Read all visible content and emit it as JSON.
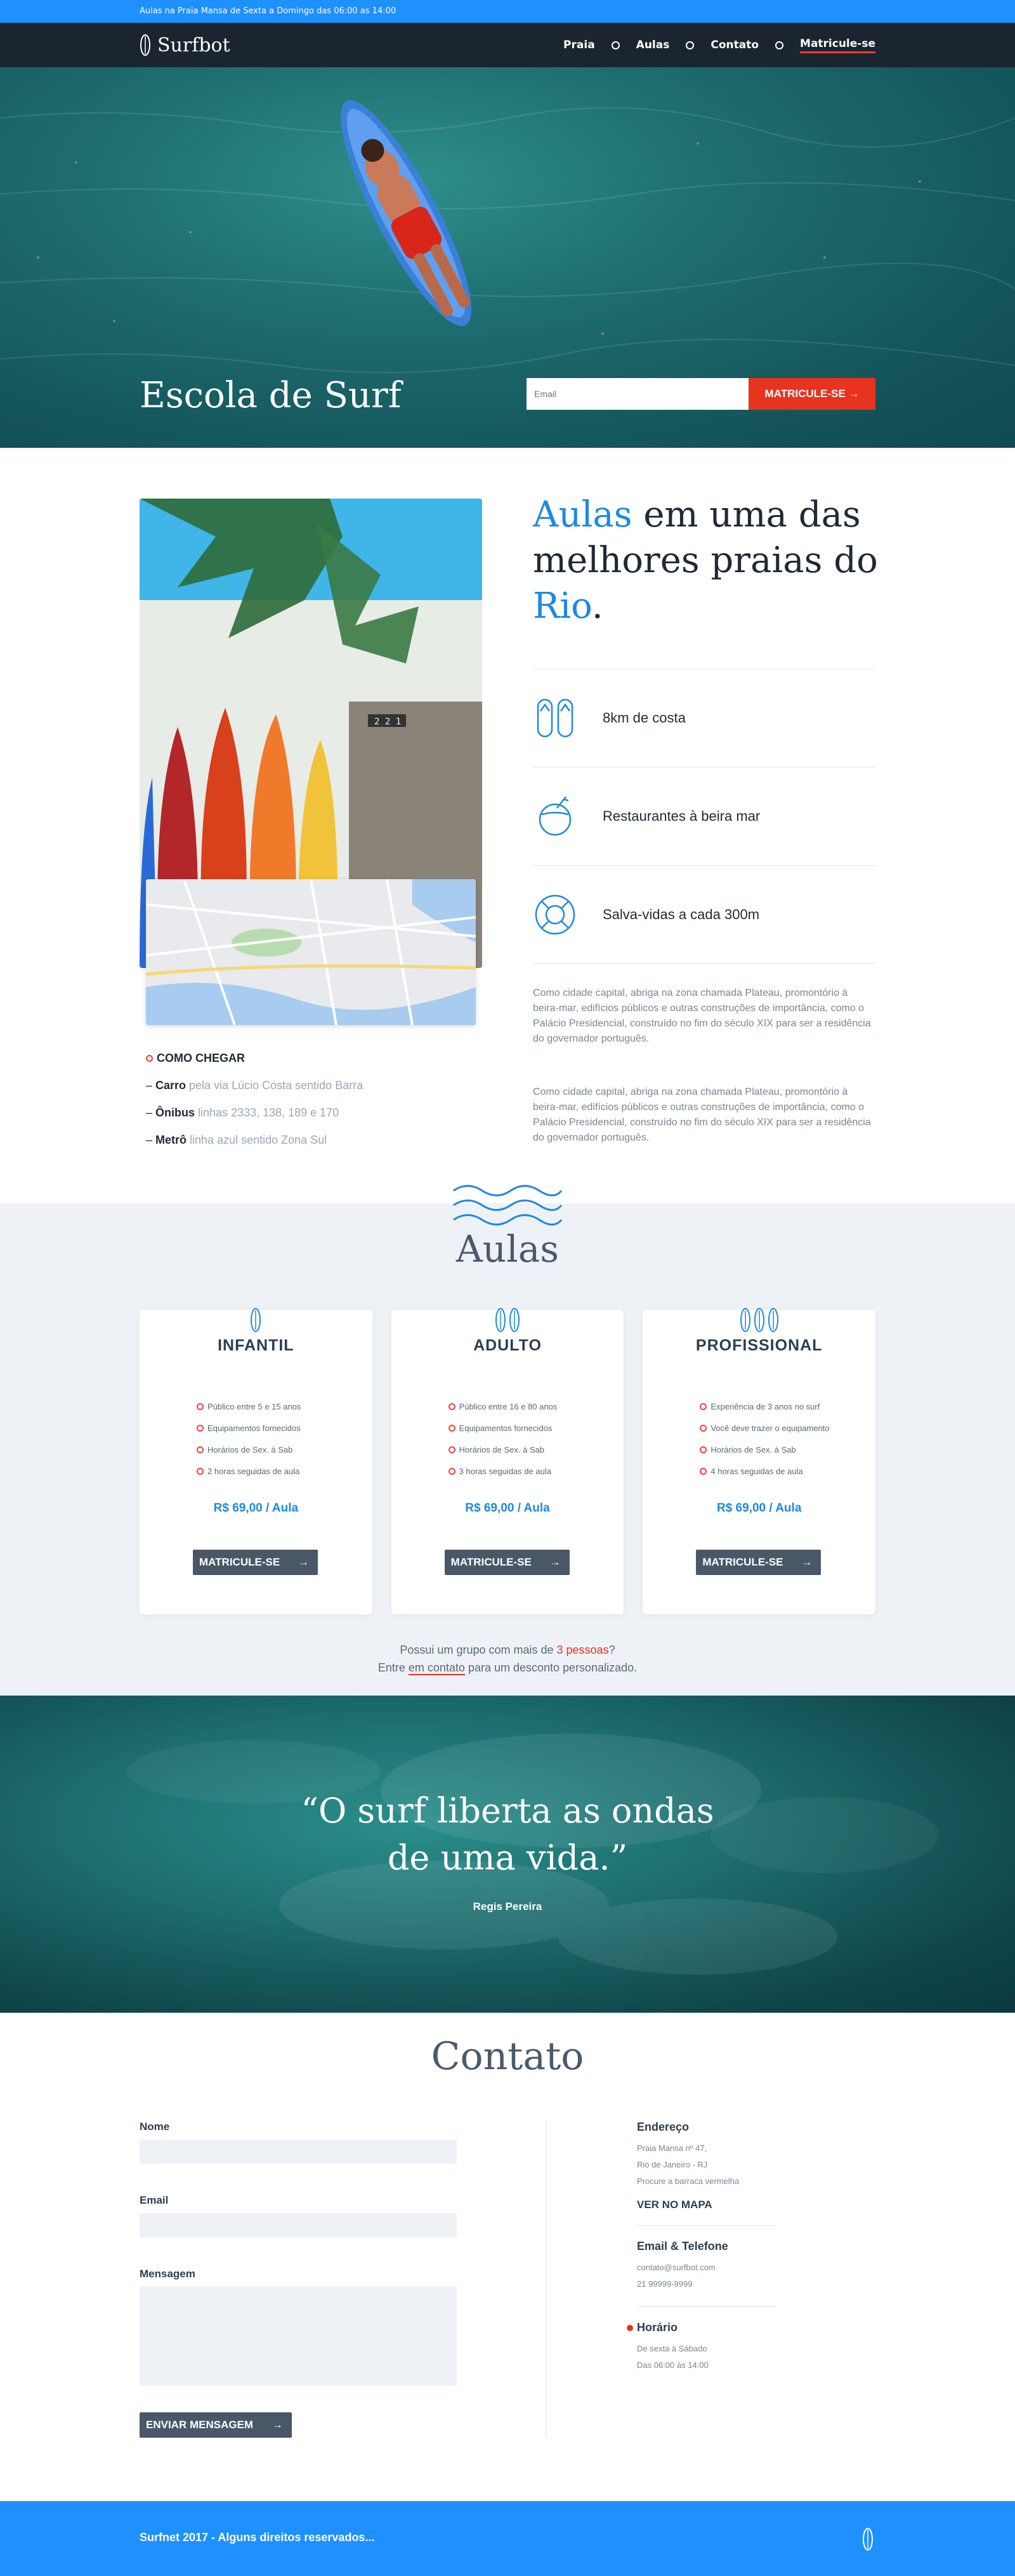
{
  "topbar": {
    "text": "Aulas na Praia Mansa de Sexta a Domingo das 06:00 as 14:00"
  },
  "nav": {
    "brand": "Surfbot",
    "links": [
      "Praia",
      "Aulas",
      "Contato",
      "Matricule-se"
    ]
  },
  "hero": {
    "title": "Escola de Surf",
    "email_placeholder": "Email",
    "cta": "MATRICULE-SE →"
  },
  "about": {
    "heading_part1": "Aulas",
    "heading_part2": " em uma das melhores praias do ",
    "heading_part3": "Rio",
    "heading_part4": ".",
    "features": [
      {
        "icon": "flip-flops-icon",
        "label": "8km de costa"
      },
      {
        "icon": "coconut-drink-icon",
        "label": "Restaurantes à beira mar"
      },
      {
        "icon": "lifebuoy-icon",
        "label": "Salva-vidas a cada 300m"
      }
    ],
    "text1": "Como cidade capital, abriga na zona chamada Plateau, promontório à beira-mar, edifícios públicos e outras construções de importância, como o Palácio Presidencial, construído no fim do século XIX para ser a residência do governador português.",
    "text2": "Como cidade capital, abriga na zona chamada Plateau, promontório à beira-mar, edifícios públicos e outras construções de importância, como o Palácio Presidencial, construído no fim do século XIX para ser a residência do governador português.",
    "directions_title": "COMO CHEGAR",
    "directions": [
      {
        "mode": "Carro",
        "detail": "pela via Lúcio Costa sentido Barra"
      },
      {
        "mode": "Ônibus",
        "detail": "linhas 2333, 138, 189 e 170"
      },
      {
        "mode": "Metrô",
        "detail": "linha azul sentido Zona Sul"
      }
    ],
    "photo_sign": "2 2 1"
  },
  "aulas": {
    "title": "Aulas",
    "cards": [
      {
        "name": "INFANTIL",
        "boards": 1,
        "items": [
          "Público entre 5 e 15 anos",
          "Equipamentos fornecidos",
          "Horários de Sex. à Sab",
          "2 horas seguidas de aula"
        ],
        "price": "R$ 69,00 / Aula",
        "button": "MATRICULE-SE"
      },
      {
        "name": "ADULTO",
        "boards": 2,
        "items": [
          "Público entre 16 e 80 anos",
          "Equipamentos fornecidos",
          "Horários de Sex. à Sab",
          "3 horas seguidas de aula"
        ],
        "price": "R$ 69,00 / Aula",
        "button": "MATRICULE-SE"
      },
      {
        "name": "PROFISSIONAL",
        "boards": 3,
        "items": [
          "Experiência de 3 anos no surf",
          "Você deve trazer o equipamento",
          "Horários de Sex. à Sab",
          "4 horas seguidas de aula"
        ],
        "price": "R$ 69,00 / Aula",
        "button": "MATRICULE-SE"
      }
    ],
    "note_part1": "Possui um grupo com mais de ",
    "note_highlight": "3 pessoas",
    "note_part2": "?",
    "note_line2_part1": "Entre ",
    "note_link": "em contato",
    "note_line2_part2": " para um desconto personalizado."
  },
  "quote": {
    "line1": "“O surf liberta as ondas",
    "line2": "de uma vida.”",
    "author": "Regis Pereira"
  },
  "contato": {
    "title": "Contato",
    "form": {
      "name_label": "Nome",
      "email_label": "Email",
      "message_label": "Mensagem",
      "send_button": "ENVIAR MENSAGEM"
    },
    "endereco_title": "Endereço",
    "endereco_lines": [
      "Praia Mansa nº 47,",
      "Rio de Janeiro - RJ",
      "Procure a barraca vermelha"
    ],
    "map_link": "VER NO MAPA",
    "email_phone_title": "Email & Telefone",
    "email_phone_lines": [
      "contato@surfbot.com",
      "21 99999-9999"
    ],
    "horario_title": "Horário",
    "horario_lines": [
      "De sexta à Sábado",
      "Das 06:00 às 14:00"
    ]
  },
  "footer": {
    "text": "Surfnet 2017 - Alguns direitos reservados..."
  },
  "colors": {
    "brand_blue": "#1e90ff",
    "accent_red": "#e8331f",
    "nav_dark": "#1b2530"
  }
}
